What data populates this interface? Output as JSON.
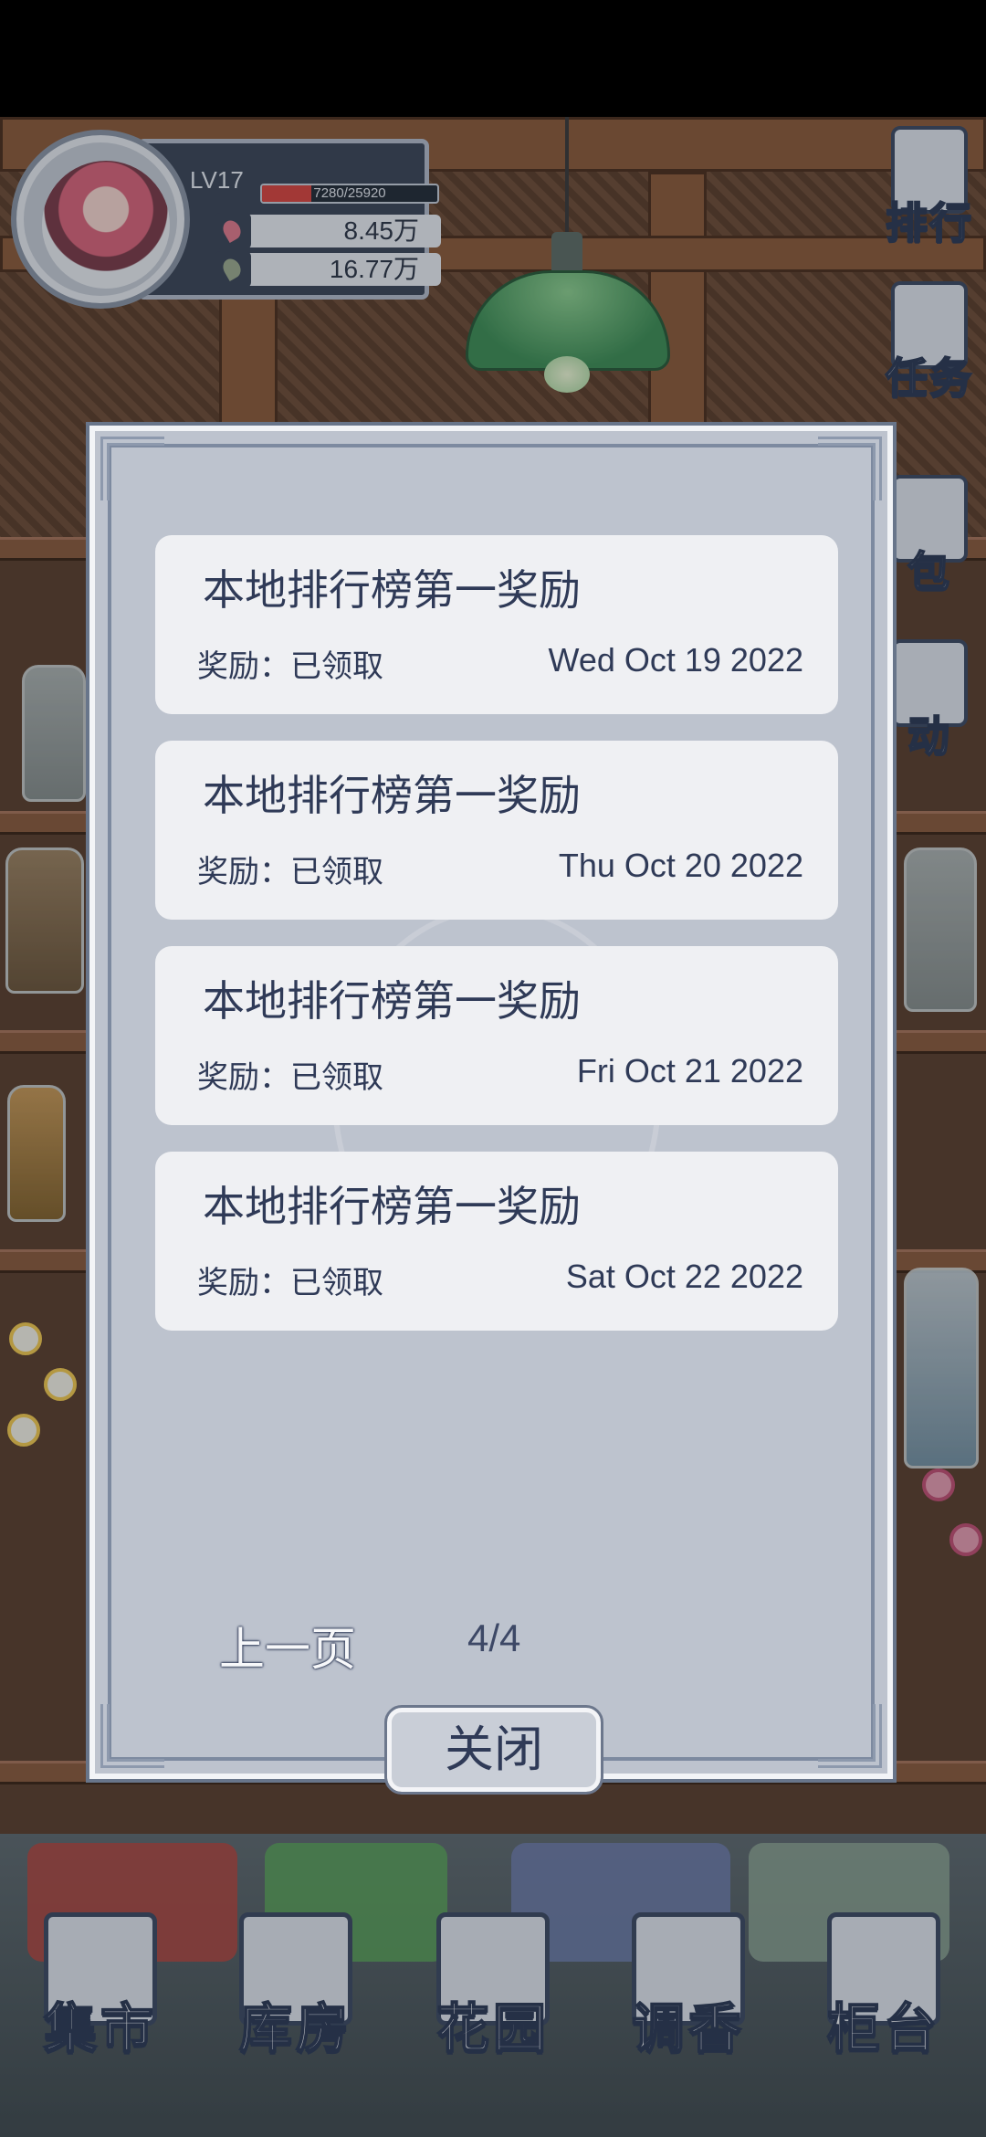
{
  "player": {
    "level": "LV17",
    "xp_text": "7280/25920",
    "xp_progress": 0.281,
    "currency_petal": "8.45万",
    "currency_leaf": "16.77万"
  },
  "side_menu": {
    "rank_label": "排行",
    "task_label": "任务",
    "bag_label": "包",
    "event_label": "动"
  },
  "dialog": {
    "items": [
      {
        "title": "本地排行榜第一奖励",
        "status": "奖励：已领取",
        "date": "Wed Oct 19 2022"
      },
      {
        "title": "本地排行榜第一奖励",
        "status": "奖励：已领取",
        "date": "Thu Oct 20 2022"
      },
      {
        "title": "本地排行榜第一奖励",
        "status": "奖励：已领取",
        "date": "Fri Oct 21 2022"
      },
      {
        "title": "本地排行榜第一奖励",
        "status": "奖励：已领取",
        "date": "Sat Oct 22 2022"
      }
    ],
    "prev_label": "上一页",
    "page_indicator": "4/4",
    "close_label": "关闭"
  },
  "bottom_nav": {
    "market": "集市",
    "warehouse": "库房",
    "garden": "花园",
    "perfume": "调香",
    "counter": "柜台"
  },
  "colors": {
    "dialog_bg": "#bdc3ce",
    "card_bg": "#eff0f3",
    "text_navy": "#2f3a57",
    "xp_red": "#d9443f"
  }
}
